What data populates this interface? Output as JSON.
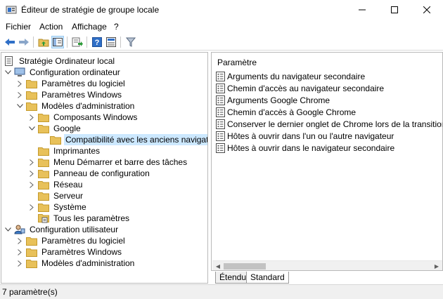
{
  "window": {
    "title": "Éditeur de stratégie de groupe locale"
  },
  "menu": [
    "Fichier",
    "Action",
    "Affichage",
    "?"
  ],
  "tree": {
    "root": "Stratégie Ordinateur local",
    "items": [
      "Configuration ordinateur",
      "Paramètres du logiciel",
      "Paramètres Windows",
      "Modèles d'administration",
      "Composants Windows",
      "Google",
      "Compatibilité avec les anciens navigateurs",
      "Imprimantes",
      "Menu Démarrer et barre des tâches",
      "Panneau de configuration",
      "Réseau",
      "Serveur",
      "Système",
      "Tous les paramètres",
      "Configuration utilisateur",
      "Paramètres du logiciel",
      "Paramètres Windows",
      "Modèles d'administration"
    ]
  },
  "details": {
    "column_header": "Paramètre",
    "rows": [
      "Arguments du navigateur secondaire",
      "Chemin d'accès au navigateur secondaire",
      "Arguments Google Chrome",
      "Chemin d'accès à Google Chrome",
      "Conserver le dernier onglet de Chrome lors de la transition",
      "Hôtes à ouvrir dans l'un ou l'autre navigateur",
      "Hôtes à ouvrir dans le navigateur secondaire"
    ]
  },
  "tabs": [
    "Étendu",
    "Standard"
  ],
  "status": "7 paramètre(s)",
  "colors": {
    "folder": "#e8c15a",
    "selection": "#cce8ff",
    "accent_blue": "#2f6fc7"
  }
}
